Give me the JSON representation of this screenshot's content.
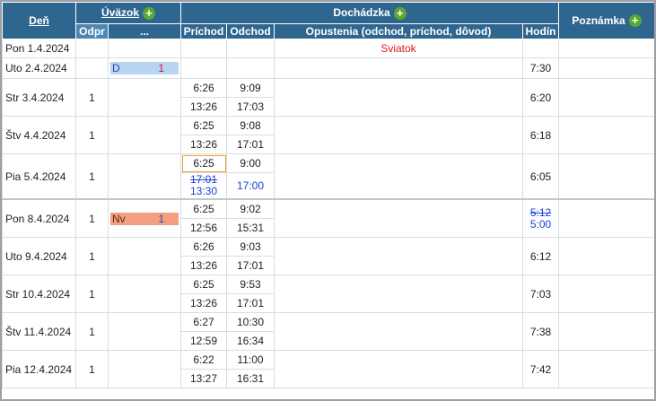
{
  "headers": {
    "den": "Deň",
    "uvazok": "Úväzok",
    "dochadzka": "Dochádzka",
    "poznamka": "Poznámka",
    "odpr": "Odpr",
    "dots": "...",
    "prichod": "Príchod",
    "odchod": "Odchod",
    "opustenia": "Opustenia (odchod, príchod, dôvod)",
    "hodin": "Hodín",
    "plus": "+"
  },
  "days": [
    {
      "den": "Pon 1.4.2024",
      "opustenia": "Sviatok"
    },
    {
      "den": "Uto 2.4.2024",
      "bar_code": "D",
      "bar_num": "1",
      "hodin": "7:30"
    },
    {
      "den": "Str 3.4.2024",
      "odpr": "1",
      "in1": "6:26",
      "out1": "9:09",
      "in2": "13:26",
      "out2": "17:03",
      "hodin": "6:20"
    },
    {
      "den": "Štv 4.4.2024",
      "odpr": "1",
      "in1": "6:25",
      "out1": "9:08",
      "in2": "13:26",
      "out2": "17:01",
      "hodin": "6:18"
    },
    {
      "den": "Pia 5.4.2024",
      "odpr": "1",
      "in1": "6:25",
      "out1": "9:00",
      "in2_old": "17:01",
      "in2": "13:30",
      "out2": "17:00",
      "hodin": "6:05"
    },
    {
      "den": "Pon 8.4.2024",
      "odpr": "1",
      "bar_code": "Nv",
      "bar_num": "1",
      "in1": "6:25",
      "out1": "9:02",
      "in2": "12:56",
      "out2": "15:31",
      "hodin_old": "5:12",
      "hodin": "5:00"
    },
    {
      "den": "Uto 9.4.2024",
      "odpr": "1",
      "in1": "6:26",
      "out1": "9:03",
      "in2": "13:26",
      "out2": "17:01",
      "hodin": "6:12"
    },
    {
      "den": "Str 10.4.2024",
      "odpr": "1",
      "in1": "6:25",
      "out1": "9:53",
      "in2": "13:26",
      "out2": "17:01",
      "hodin": "7:03"
    },
    {
      "den": "Štv 11.4.2024",
      "odpr": "1",
      "in1": "6:27",
      "out1": "10:30",
      "in2": "12:59",
      "out2": "16:34",
      "hodin": "7:38"
    },
    {
      "den": "Pia 12.4.2024",
      "odpr": "1",
      "in1": "6:22",
      "out1": "11:00",
      "in2": "13:27",
      "out2": "16:31",
      "hodin": "7:42"
    }
  ]
}
